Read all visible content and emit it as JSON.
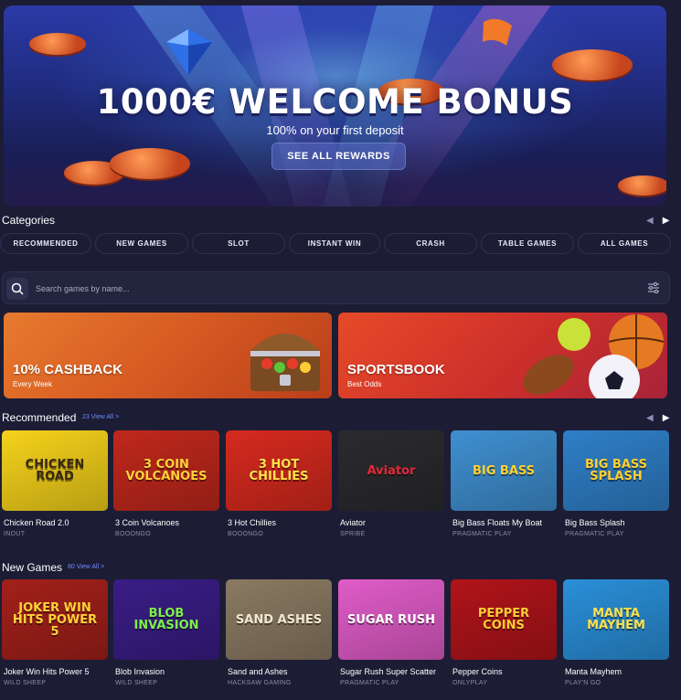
{
  "hero": {
    "title": "1000€ WELCOME BONUS",
    "subtitle": "100% on your first deposit",
    "button_label": "SEE ALL REWARDS"
  },
  "categories": {
    "title": "Categories",
    "items": [
      "RECOMMENDED",
      "NEW GAMES",
      "SLOT",
      "INSTANT WIN",
      "CRASH",
      "TABLE GAMES",
      "ALL GAMES"
    ]
  },
  "search": {
    "placeholder": "Search games by name..."
  },
  "promos": [
    {
      "title": "10% CASHBACK",
      "subtitle": "Every Week"
    },
    {
      "title": "SPORTSBOOK",
      "subtitle": "Best Odds"
    }
  ],
  "recommended": {
    "title": "Recommended",
    "view_all": "23 View All",
    "games": [
      {
        "name": "Chicken Road 2.0",
        "provider": "INOUT",
        "art": "CHICKEN ROAD",
        "bg": "#f5d21b",
        "fg": "#3a2a10"
      },
      {
        "name": "3 Coin Volcanoes",
        "provider": "BOOONGO",
        "art": "3 COIN VOLCANOES",
        "bg": "#c0281c",
        "fg": "#ffd23a"
      },
      {
        "name": "3 Hot Chillies",
        "provider": "BOOONGO",
        "art": "3 HOT CHILLIES",
        "bg": "#d62a1e",
        "fg": "#ffe14a"
      },
      {
        "name": "Aviator",
        "provider": "SPRIBE",
        "art": "Aviator",
        "bg": "#2b2b2e",
        "fg": "#e0283a"
      },
      {
        "name": "Big Bass Floats My Boat",
        "provider": "PRAGMATIC PLAY",
        "art": "BIG BASS",
        "bg": "#3f8fd0",
        "fg": "#ffcf2e"
      },
      {
        "name": "Big Bass Splash",
        "provider": "PRAGMATIC PLAY",
        "art": "BIG BASS SPLASH",
        "bg": "#2f7fc8",
        "fg": "#ffcf2e"
      }
    ]
  },
  "new_games": {
    "title": "New Games",
    "view_all": "80 View All",
    "games": [
      {
        "name": "Joker Win Hits Power 5",
        "provider": "WILD SHEEP",
        "art": "JOKER WIN HITS POWER 5",
        "bg": "#a3201a",
        "fg": "#ffd23a"
      },
      {
        "name": "Blob Invasion",
        "provider": "WILD SHEEP",
        "art": "BLOB INVASION",
        "bg": "#3a1d86",
        "fg": "#7cf04a"
      },
      {
        "name": "Sand and Ashes",
        "provider": "HACKSAW GAMING",
        "art": "SAND ASHES",
        "bg": "#8a7a62",
        "fg": "#f2e8d0"
      },
      {
        "name": "Sugar Rush Super Scatter",
        "provider": "PRAGMATIC PLAY",
        "art": "SUGAR RUSH",
        "bg": "#e05cc8",
        "fg": "#ffffff"
      },
      {
        "name": "Pepper Coins",
        "provider": "ONLYPLAY",
        "art": "PEPPER COINS",
        "bg": "#b0141a",
        "fg": "#ffcc33"
      },
      {
        "name": "Manta Mayhem",
        "provider": "PLAY'N GO",
        "art": "MANTA MAYHEM",
        "bg": "#2a8fd8",
        "fg": "#ffe14a"
      }
    ]
  },
  "colors": {
    "background": "#1c1d35",
    "accent": "#6e8bff",
    "pill_border": "#2e3050"
  }
}
